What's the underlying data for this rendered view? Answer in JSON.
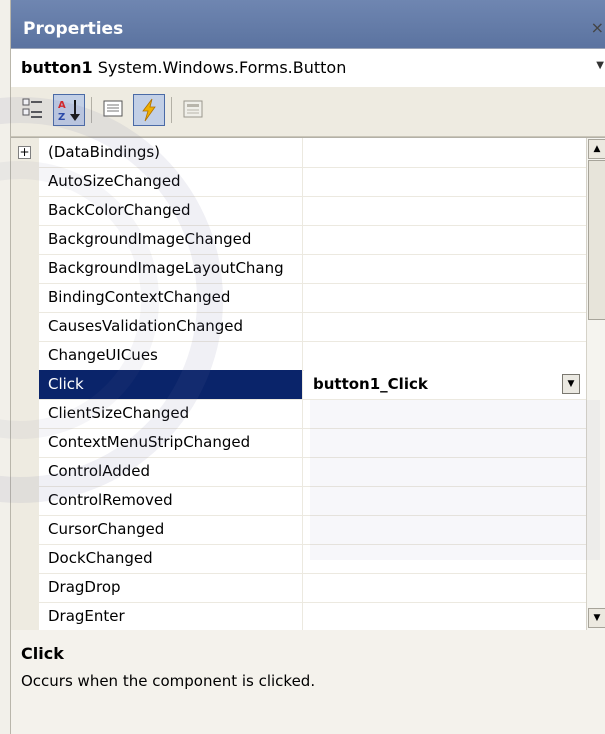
{
  "window": {
    "title": "Properties",
    "close_glyph": "×"
  },
  "object_selector": {
    "name": "button1",
    "type": "System.Windows.Forms.Button",
    "arrow": "▼"
  },
  "toolbar": {
    "buttons": [
      {
        "icon": "categorized-icon",
        "active": false
      },
      {
        "icon": "alphabetical-sort-icon",
        "active": true
      },
      {
        "icon": "properties-icon",
        "active": false
      },
      {
        "icon": "events-lightning-icon",
        "active": true
      },
      {
        "icon": "property-pages-icon",
        "active": false
      }
    ]
  },
  "grid": {
    "rows": [
      {
        "name": "(DataBindings)",
        "value": "",
        "expander": "+"
      },
      {
        "name": "AutoSizeChanged",
        "value": ""
      },
      {
        "name": "BackColorChanged",
        "value": ""
      },
      {
        "name": "BackgroundImageChanged",
        "value": ""
      },
      {
        "name": "BackgroundImageLayoutChang",
        "value": ""
      },
      {
        "name": "BindingContextChanged",
        "value": ""
      },
      {
        "name": "CausesValidationChanged",
        "value": ""
      },
      {
        "name": "ChangeUICues",
        "value": ""
      },
      {
        "name": "Click",
        "value": "button1_Click",
        "selected": true
      },
      {
        "name": "ClientSizeChanged",
        "value": ""
      },
      {
        "name": "ContextMenuStripChanged",
        "value": ""
      },
      {
        "name": "ControlAdded",
        "value": ""
      },
      {
        "name": "ControlRemoved",
        "value": ""
      },
      {
        "name": "CursorChanged",
        "value": ""
      },
      {
        "name": "DockChanged",
        "value": ""
      },
      {
        "name": "DragDrop",
        "value": ""
      },
      {
        "name": "DragEnter",
        "value": ""
      }
    ],
    "dropdown_glyph": "▼",
    "scroll_up_glyph": "▲",
    "scroll_down_glyph": "▼"
  },
  "description": {
    "title": "Click",
    "text": "Occurs when the component is clicked."
  },
  "colors": {
    "title_bar": "#5f77a6",
    "selection": "#0a246a",
    "toolbar_active": "#c2cfe6"
  }
}
